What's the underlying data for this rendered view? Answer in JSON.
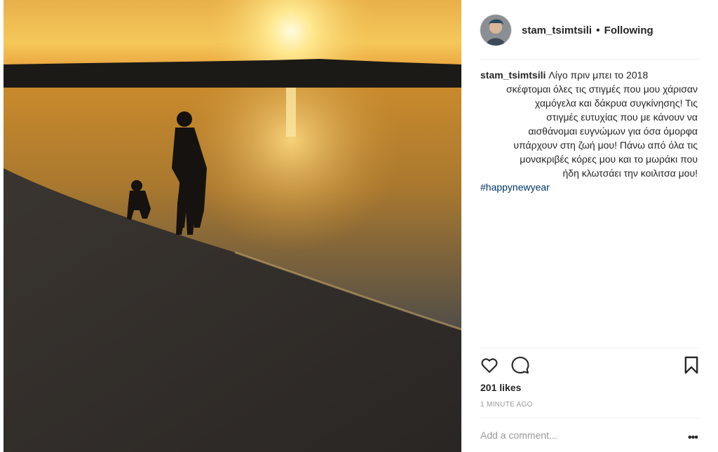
{
  "post": {
    "username": "stam_tsimtsili",
    "separator": "•",
    "follow_status": "Following",
    "caption_lines": [
      "Λίγο πριν μπει το 2018",
      "σκέφτομαι όλες τις στιγμές που μου χάρισαν",
      "χαμόγελα και δάκρυα συγκίνησης! Τις",
      "στιγμές ευτυχίας που με κάνουν να",
      "αισθάνομαι ευγνώμων για όσα όμορφα",
      "υπάρχουν στη ζωή μου! Πάνω από όλα τις",
      "μονακριβές κόρες μου και το μωράκι που",
      "ήδη κλωτσάει την κοιλιτσα μου!"
    ],
    "hashtag": "#happynewyear",
    "likes": "201 likes",
    "timestamp": "1 MINUTE AGO",
    "comment_placeholder": "Add a comment...",
    "more_label": "•••"
  },
  "icons": {
    "like": "heart-icon",
    "comment": "comment-icon",
    "save": "bookmark-icon",
    "more": "more-options-icon"
  },
  "colors": {
    "text": "#262626",
    "muted": "#999999",
    "hashtag": "#003569",
    "divider": "#efefef"
  }
}
